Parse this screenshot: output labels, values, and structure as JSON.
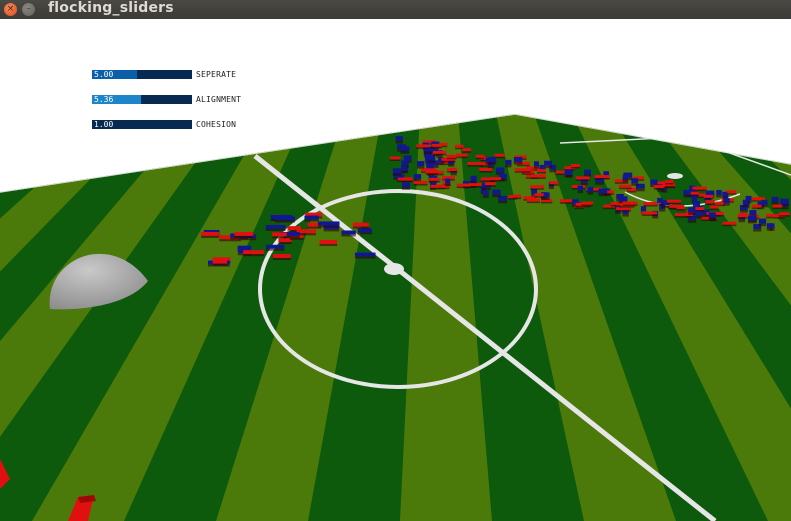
{
  "window": {
    "title": "flocking_sliders",
    "close_glyph": "×",
    "minimize_glyph": "–"
  },
  "sliders": [
    {
      "label": "SEPERATE",
      "value_text": "5.00",
      "fill_fraction": 0.45,
      "fill_color": "#0b5fa8"
    },
    {
      "label": "ALIGNMENT",
      "value_text": "5.36",
      "fill_fraction": 0.49,
      "fill_color": "#1c86c8"
    },
    {
      "label": "COHESION",
      "value_text": "1.00",
      "fill_fraction": 0.0,
      "fill_color": "#0b5fa8"
    }
  ],
  "scene": {
    "grass_dark": "#0d5a0c",
    "grass_light": "#4c7a0a",
    "line_color": "#e8e8e8",
    "obstacle_color": "#9e9e9e",
    "boid_colors": [
      "#e01010",
      "#101890"
    ]
  }
}
